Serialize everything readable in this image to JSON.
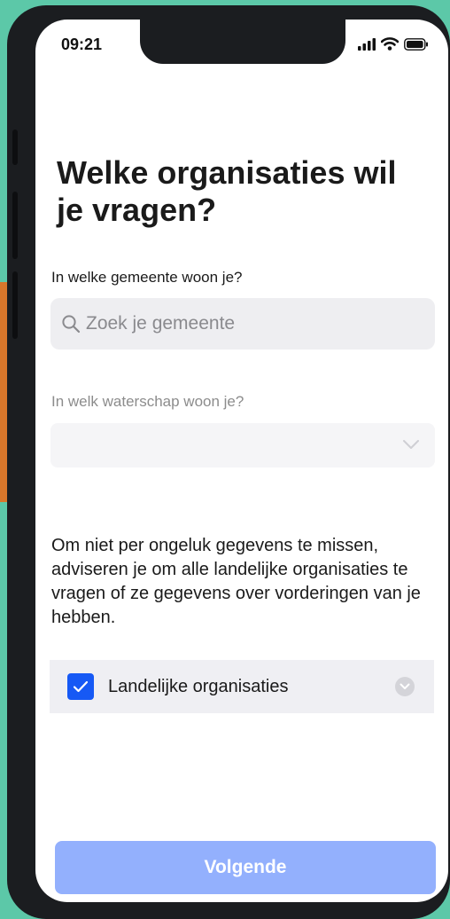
{
  "status_bar": {
    "time": "09:21",
    "icons": [
      "signal-icon",
      "wifi-icon",
      "battery-icon"
    ]
  },
  "page": {
    "title": "Welke organisaties wil je vragen?"
  },
  "municipality": {
    "label": "In welke gemeente woon je?",
    "search_placeholder": "Zoek je gemeente",
    "icon": "search-icon"
  },
  "water_board": {
    "label": "In welk waterschap woon je?",
    "value": "",
    "icon": "chevron-down-icon"
  },
  "info_text": "Om niet per ongeluk gegevens te missen, adviseren je om alle landelijke organisaties te vragen of ze gegevens over vorderingen van je hebben.",
  "national": {
    "label": "Landelijke organisaties",
    "checked": true,
    "icon": "chevron-down-icon"
  },
  "footer": {
    "next_label": "Volgende"
  },
  "colors": {
    "primary": "#1659f5",
    "button_disabled": "#93b0fd",
    "input_bg": "#eeeef1",
    "background_side": "#5cc8a8"
  }
}
